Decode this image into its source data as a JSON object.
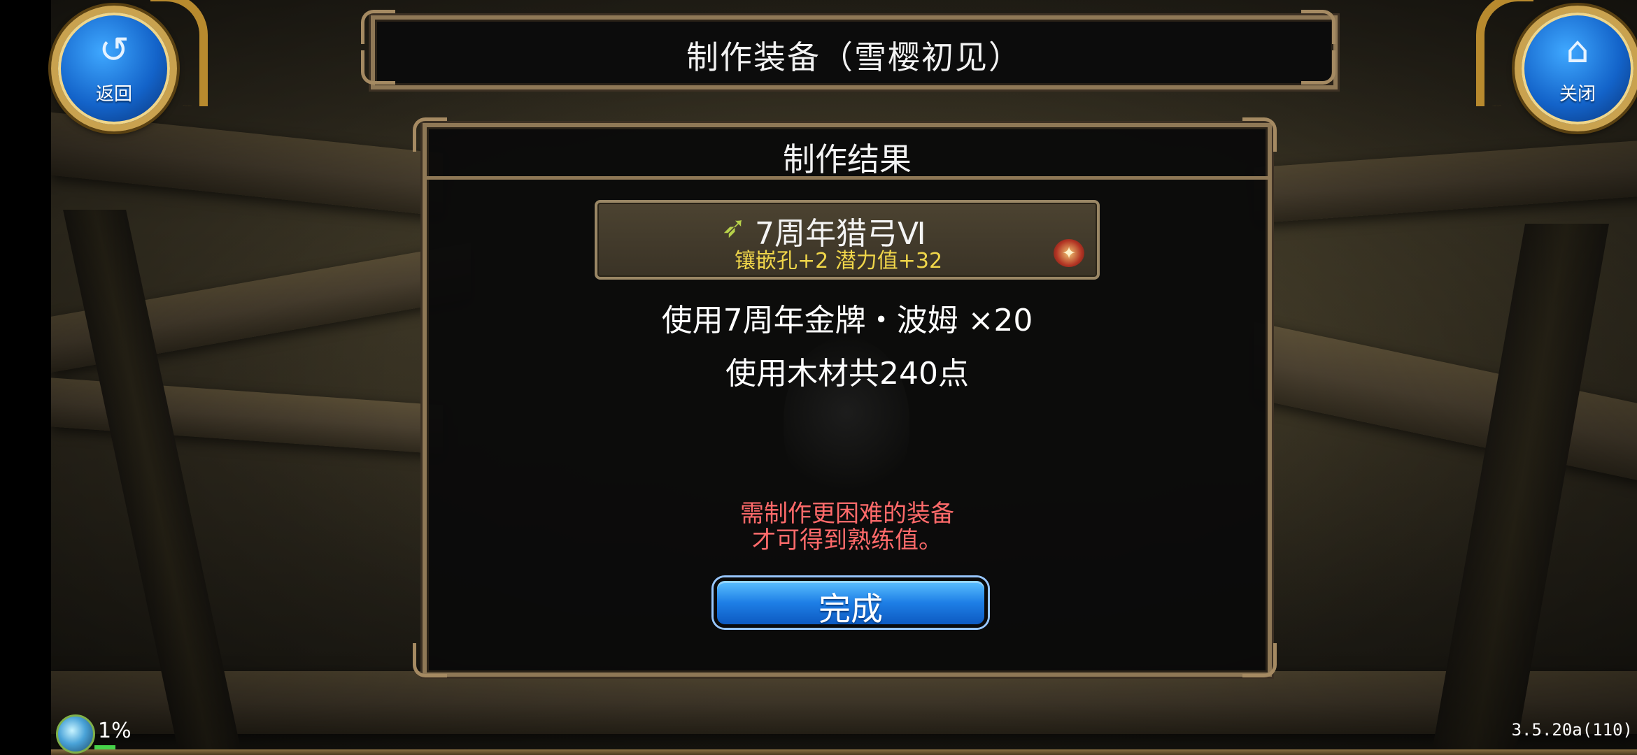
{
  "header": {
    "back_glyph": "↺",
    "back_label": "返回",
    "close_glyph": "⌂",
    "close_label": "关闭",
    "title": "制作装备（雪樱初见）"
  },
  "dialog": {
    "title": "制作结果",
    "item": {
      "icon": "bow-icon",
      "icon_glyph": "➶",
      "name": "7周年猎弓Ⅵ",
      "stats": "镶嵌孔+2  潜力值+32",
      "badge_icon": "treasure-chest-icon",
      "badge_glyph": "✦"
    },
    "materials_line": "使用7周年金牌・波姆 ×20",
    "wood_line": "使用木材共240点",
    "warning_line1": "需制作更困难的装备",
    "warning_line2": "才可得到熟练值。",
    "done_label": "完成"
  },
  "hud": {
    "percent": "1%",
    "version": "3.5.20a(110)"
  },
  "colors": {
    "accent_blue": "#1e7fe6",
    "warning_red": "#ff6a6a",
    "stat_yellow": "#f0d64a",
    "frame_gold": "#8f7856"
  }
}
